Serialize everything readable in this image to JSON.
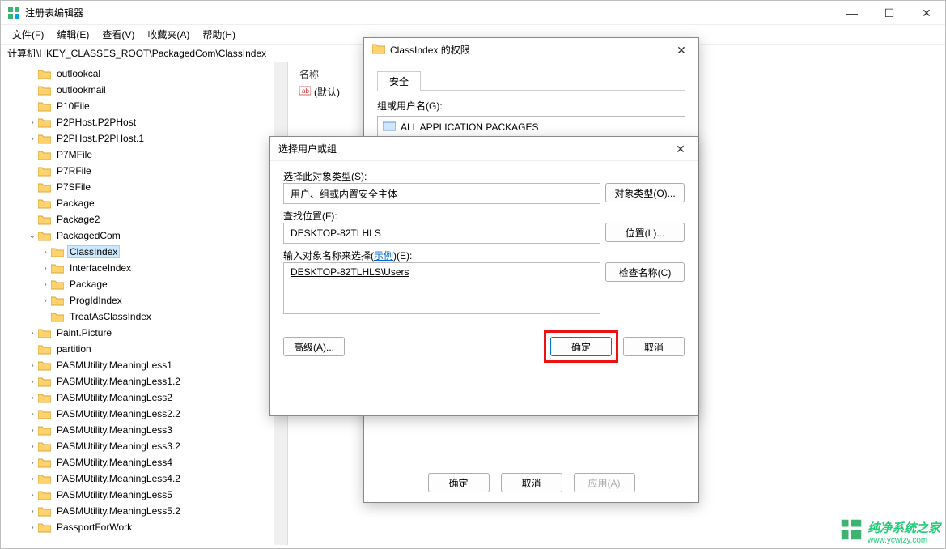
{
  "window": {
    "title": "注册表编辑器",
    "controls": {
      "min": "—",
      "max": "☐",
      "close": "✕"
    }
  },
  "menu": {
    "file": "文件(F)",
    "edit": "编辑(E)",
    "view": "查看(V)",
    "favorites": "收藏夹(A)",
    "help": "帮助(H)"
  },
  "address": "计算机\\HKEY_CLASSES_ROOT\\PackagedCom\\ClassIndex",
  "tree": {
    "items": [
      {
        "indent": 2,
        "twisty": "",
        "label": "outlookcal"
      },
      {
        "indent": 2,
        "twisty": "",
        "label": "outlookmail"
      },
      {
        "indent": 2,
        "twisty": "",
        "label": "P10File"
      },
      {
        "indent": 2,
        "twisty": ">",
        "label": "P2PHost.P2PHost"
      },
      {
        "indent": 2,
        "twisty": ">",
        "label": "P2PHost.P2PHost.1"
      },
      {
        "indent": 2,
        "twisty": "",
        "label": "P7MFile"
      },
      {
        "indent": 2,
        "twisty": "",
        "label": "P7RFile"
      },
      {
        "indent": 2,
        "twisty": "",
        "label": "P7SFile"
      },
      {
        "indent": 2,
        "twisty": "",
        "label": "Package"
      },
      {
        "indent": 2,
        "twisty": "",
        "label": "Package2"
      },
      {
        "indent": 2,
        "twisty": "v",
        "label": "PackagedCom"
      },
      {
        "indent": 3,
        "twisty": ">",
        "label": "ClassIndex",
        "selected": true
      },
      {
        "indent": 3,
        "twisty": ">",
        "label": "InterfaceIndex"
      },
      {
        "indent": 3,
        "twisty": ">",
        "label": "Package"
      },
      {
        "indent": 3,
        "twisty": ">",
        "label": "ProgIdIndex"
      },
      {
        "indent": 3,
        "twisty": "",
        "label": "TreatAsClassIndex"
      },
      {
        "indent": 2,
        "twisty": ">",
        "label": "Paint.Picture"
      },
      {
        "indent": 2,
        "twisty": "",
        "label": "partition"
      },
      {
        "indent": 2,
        "twisty": ">",
        "label": "PASMUtility.MeaningLess1"
      },
      {
        "indent": 2,
        "twisty": ">",
        "label": "PASMUtility.MeaningLess1.2"
      },
      {
        "indent": 2,
        "twisty": ">",
        "label": "PASMUtility.MeaningLess2"
      },
      {
        "indent": 2,
        "twisty": ">",
        "label": "PASMUtility.MeaningLess2.2"
      },
      {
        "indent": 2,
        "twisty": ">",
        "label": "PASMUtility.MeaningLess3"
      },
      {
        "indent": 2,
        "twisty": ">",
        "label": "PASMUtility.MeaningLess3.2"
      },
      {
        "indent": 2,
        "twisty": ">",
        "label": "PASMUtility.MeaningLess4"
      },
      {
        "indent": 2,
        "twisty": ">",
        "label": "PASMUtility.MeaningLess4.2"
      },
      {
        "indent": 2,
        "twisty": ">",
        "label": "PASMUtility.MeaningLess5"
      },
      {
        "indent": 2,
        "twisty": ">",
        "label": "PASMUtility.MeaningLess5.2"
      },
      {
        "indent": 2,
        "twisty": ">",
        "label": "PassportForWork"
      }
    ]
  },
  "list": {
    "col_name": "名称",
    "default_value": "(默认)"
  },
  "perm_dialog": {
    "title": "ClassIndex 的权限",
    "tab": "安全",
    "group_label": "组或用户名(G):",
    "group_value": "ALL APPLICATION PACKAGES",
    "ok": "确定",
    "cancel": "取消",
    "apply": "应用(A)"
  },
  "select_dialog": {
    "title": "选择用户或组",
    "object_type_label": "选择此对象类型(S):",
    "object_type_value": "用户、组或内置安全主体",
    "object_type_btn": "对象类型(O)...",
    "location_label": "查找位置(F):",
    "location_value": "DESKTOP-82TLHLS",
    "location_btn": "位置(L)...",
    "name_label_prefix": "输入对象名称来选择(",
    "name_label_link": "示例",
    "name_label_suffix": ")(E):",
    "name_value": "DESKTOP-82TLHLS\\Users",
    "check_btn": "检查名称(C)",
    "advanced_btn": "高级(A)...",
    "ok": "确定",
    "cancel": "取消"
  },
  "watermark": {
    "text": "纯净系统之家",
    "url": "www.ycwjzy.com"
  }
}
